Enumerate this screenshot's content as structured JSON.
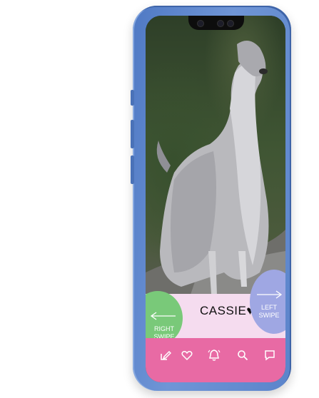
{
  "profile": {
    "name": "CASSIE",
    "heart": "♥"
  },
  "swipe": {
    "right_line1": "RIGHT",
    "right_line2": "SWIPE",
    "left_line1": "LEFT",
    "left_line2": "SWIPE"
  },
  "tabs": [
    {
      "icon": "edit-icon"
    },
    {
      "icon": "heart-icon"
    },
    {
      "icon": "bell-icon"
    },
    {
      "icon": "search-icon"
    },
    {
      "icon": "chat-icon"
    }
  ],
  "colors": {
    "phone_frame": "#5b84cb",
    "name_bar": "#f5dcef",
    "right_swipe": "#79c979",
    "left_swipe": "#9fa7e3",
    "tab_bar": "#e86aa4"
  }
}
